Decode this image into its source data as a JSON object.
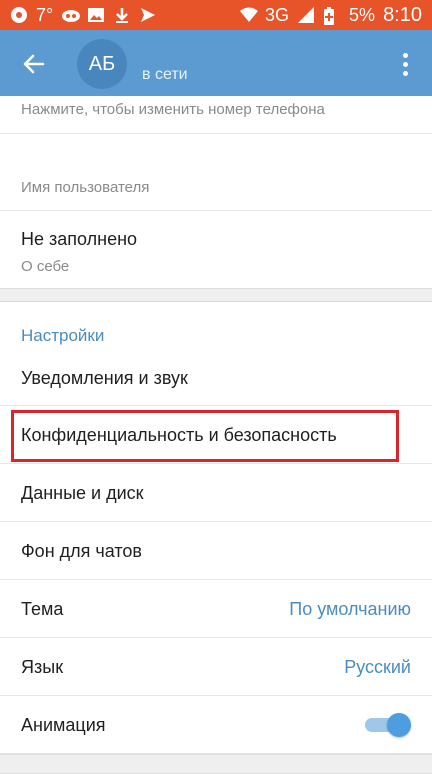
{
  "status_bar": {
    "signal_count": "7°",
    "network": "3G",
    "battery": "5%",
    "time": "8:10"
  },
  "header": {
    "avatar_initials": "АБ",
    "status": "в сети"
  },
  "profile": {
    "phone_hint": "Нажмите, чтобы изменить номер телефона",
    "username_label": "Имя пользователя",
    "bio_value": "Не заполнено",
    "bio_label": "О себе"
  },
  "settings": {
    "section_title": "Настройки",
    "items": [
      {
        "label": "Уведомления и звук"
      },
      {
        "label": "Конфиденциальность и безопасность"
      },
      {
        "label": "Данные и диск"
      },
      {
        "label": "Фон для чатов"
      },
      {
        "label": "Тема",
        "value": "По умолчанию"
      },
      {
        "label": "Язык",
        "value": "Русский"
      },
      {
        "label": "Анимация",
        "toggle_on": true
      }
    ]
  },
  "colors": {
    "status_bar": "#e8542a",
    "header": "#5b9bd1",
    "accent": "#4a8cc2",
    "highlight": "#d9252b"
  }
}
